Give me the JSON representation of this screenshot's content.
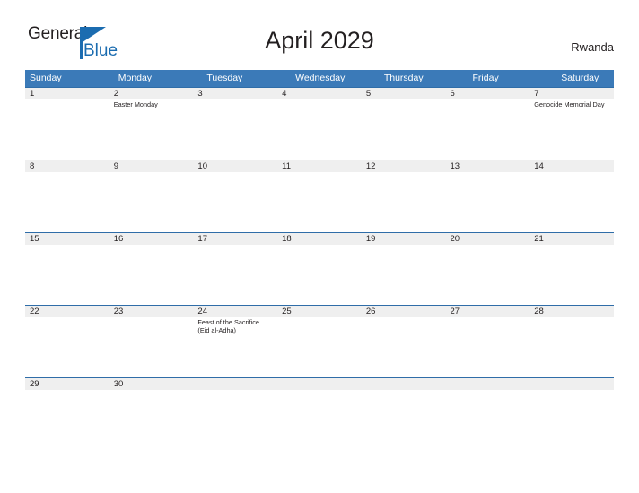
{
  "brand": {
    "name_part1": "General",
    "name_part2": "Blue",
    "accent_color": "#1b6cb0"
  },
  "header": {
    "title": "April 2029",
    "country": "Rwanda"
  },
  "calendar": {
    "header_bg": "#3b7ab8",
    "date_band_bg": "#efefef",
    "row_line_color": "#2f6da8",
    "weekday_headers": [
      "Sunday",
      "Monday",
      "Tuesday",
      "Wednesday",
      "Thursday",
      "Friday",
      "Saturday"
    ],
    "weeks": [
      {
        "days": [
          {
            "date": "1",
            "event": ""
          },
          {
            "date": "2",
            "event": "Easter Monday"
          },
          {
            "date": "3",
            "event": ""
          },
          {
            "date": "4",
            "event": ""
          },
          {
            "date": "5",
            "event": ""
          },
          {
            "date": "6",
            "event": ""
          },
          {
            "date": "7",
            "event": "Genocide Memorial Day"
          }
        ]
      },
      {
        "days": [
          {
            "date": "8",
            "event": ""
          },
          {
            "date": "9",
            "event": ""
          },
          {
            "date": "10",
            "event": ""
          },
          {
            "date": "11",
            "event": ""
          },
          {
            "date": "12",
            "event": ""
          },
          {
            "date": "13",
            "event": ""
          },
          {
            "date": "14",
            "event": ""
          }
        ]
      },
      {
        "days": [
          {
            "date": "15",
            "event": ""
          },
          {
            "date": "16",
            "event": ""
          },
          {
            "date": "17",
            "event": ""
          },
          {
            "date": "18",
            "event": ""
          },
          {
            "date": "19",
            "event": ""
          },
          {
            "date": "20",
            "event": ""
          },
          {
            "date": "21",
            "event": ""
          }
        ]
      },
      {
        "days": [
          {
            "date": "22",
            "event": ""
          },
          {
            "date": "23",
            "event": ""
          },
          {
            "date": "24",
            "event": "Feast of the Sacrifice (Eid al-Adha)"
          },
          {
            "date": "25",
            "event": ""
          },
          {
            "date": "26",
            "event": ""
          },
          {
            "date": "27",
            "event": ""
          },
          {
            "date": "28",
            "event": ""
          }
        ]
      },
      {
        "short": true,
        "days": [
          {
            "date": "29",
            "event": ""
          },
          {
            "date": "30",
            "event": ""
          },
          {
            "date": "",
            "event": ""
          },
          {
            "date": "",
            "event": ""
          },
          {
            "date": "",
            "event": ""
          },
          {
            "date": "",
            "event": ""
          },
          {
            "date": "",
            "event": ""
          }
        ]
      }
    ]
  }
}
